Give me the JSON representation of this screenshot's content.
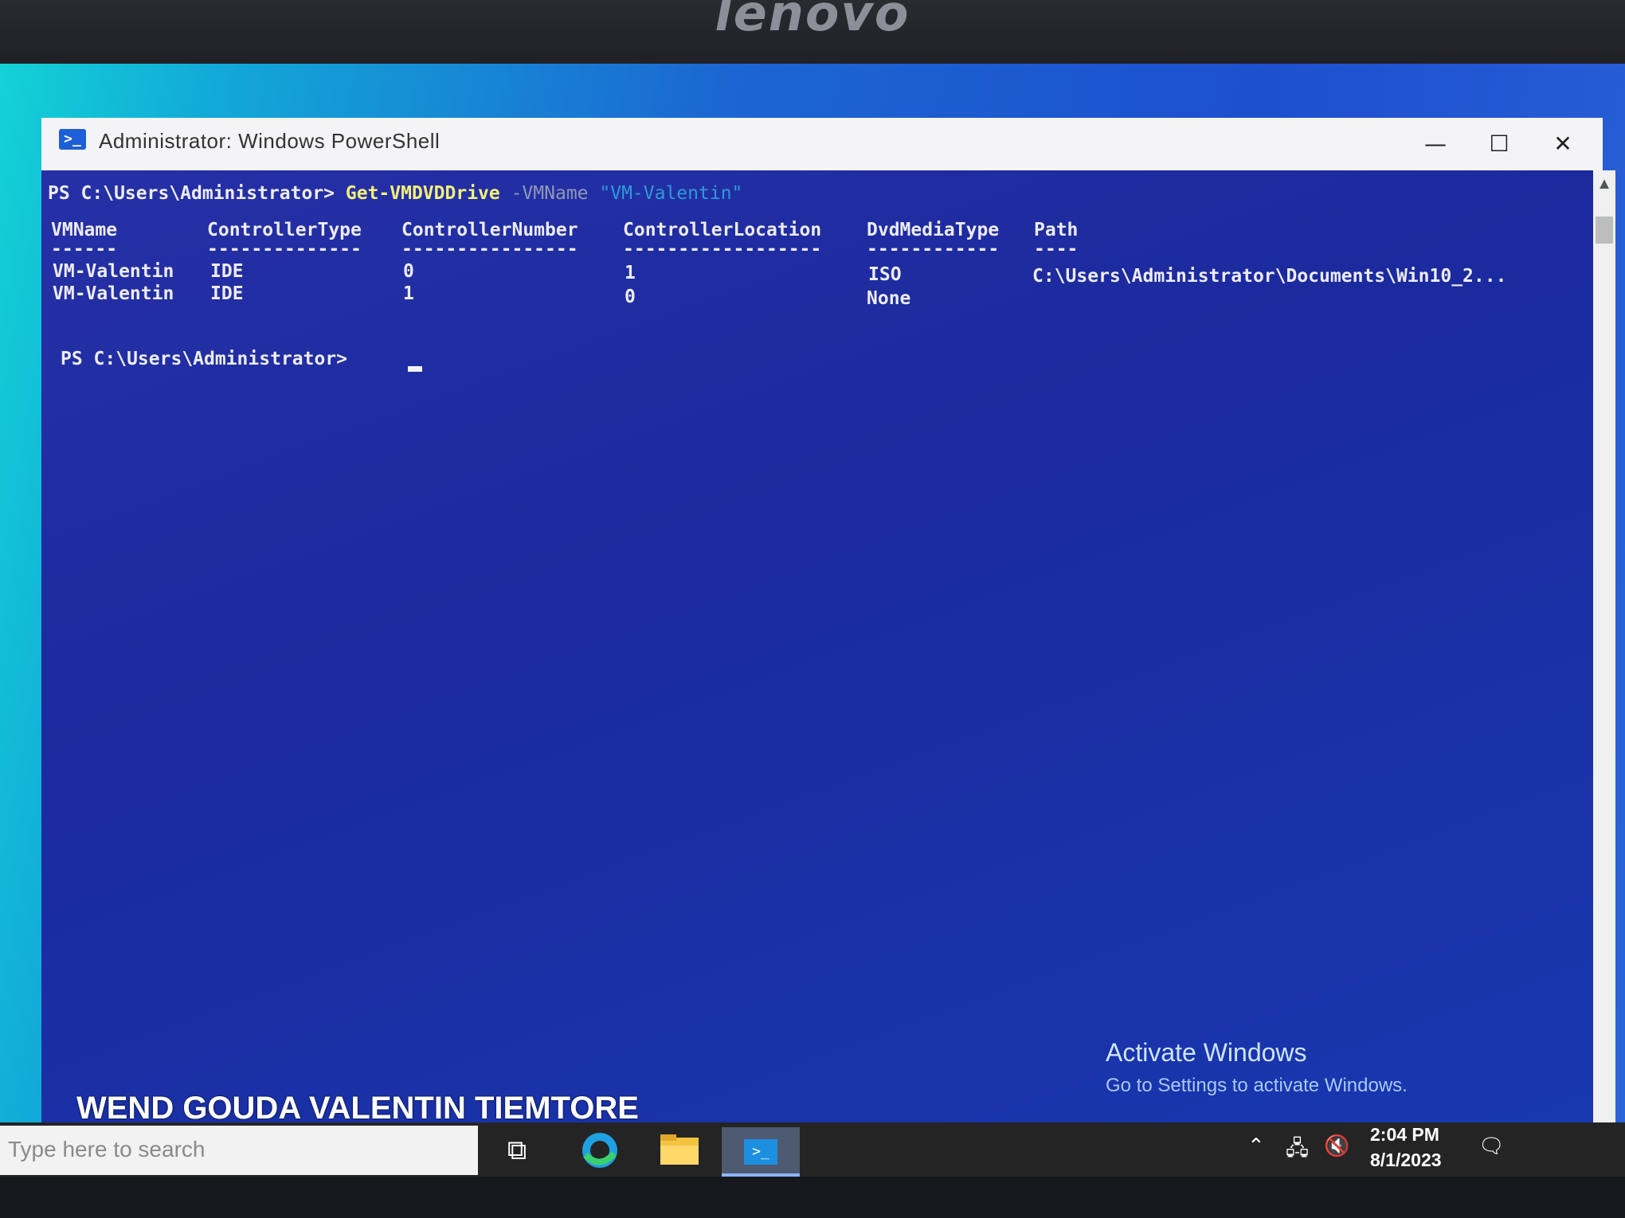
{
  "bezel": {
    "brand": "lenovo"
  },
  "window": {
    "title": "Administrator: Windows PowerShell",
    "minimize": "—",
    "maximize": "☐",
    "close": "✕"
  },
  "console": {
    "prompt1": "PS C:\\Users\\Administrator> ",
    "cmdlet": "Get-VMDVDDrive",
    "param": " -VMName ",
    "param_value": "\"VM-Valentin\"",
    "headers": [
      "VMName",
      "ControllerType",
      "ControllerNumber",
      "ControllerLocation",
      "DvdMediaType",
      "Path"
    ],
    "separators": [
      "------",
      "--------------",
      "----------------",
      "------------------",
      "------------",
      "----"
    ],
    "rows": [
      [
        "VM-Valentin",
        "IDE",
        "0",
        "1",
        "ISO",
        "C:\\Users\\Administrator\\Documents\\Win10_2..."
      ],
      [
        "VM-Valentin",
        "IDE",
        "1",
        "0",
        "None",
        ""
      ]
    ],
    "prompt2": "PS C:\\Users\\Administrator> "
  },
  "activation": {
    "title": "Activate Windows",
    "subtitle": "Go to Settings to activate Windows."
  },
  "watermark": "WEND GOUDA VALENTIN TIEMTORE",
  "taskbar": {
    "search_placeholder": "Type here to search",
    "time": "2:04 PM",
    "date": "8/1/2023"
  },
  "icons": {
    "powershell": "powershell-icon",
    "task_view": "task-view-icon",
    "edge": "edge-icon",
    "explorer": "file-explorer-icon",
    "tray_up": "chevron-up-icon",
    "network": "network-icon",
    "volume": "volume-muted-icon",
    "notifications": "notification-icon"
  }
}
